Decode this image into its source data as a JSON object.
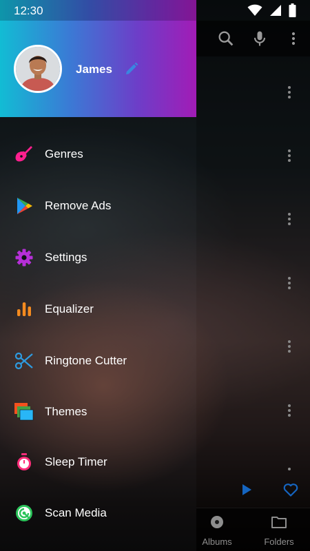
{
  "status_bar": {
    "time": "12:30"
  },
  "drawer": {
    "user": {
      "name": "James"
    },
    "menu": [
      {
        "label": "Genres",
        "icon": "guitar-icon",
        "color": "#ff1f8e"
      },
      {
        "label": "Remove Ads",
        "icon": "play-store-icon",
        "color": "#34a853"
      },
      {
        "label": "Settings",
        "icon": "gear-icon",
        "color": "#b62fd8"
      },
      {
        "label": "Equalizer",
        "icon": "equalizer-icon",
        "color": "#f58b1f"
      },
      {
        "label": "Ringtone Cutter",
        "icon": "scissors-icon",
        "color": "#2e9be0"
      },
      {
        "label": "Themes",
        "icon": "themes-icon",
        "color": "#4caf50"
      },
      {
        "label": "Sleep Timer",
        "icon": "stopwatch-icon",
        "color": "#ff2d7a"
      },
      {
        "label": "Scan Media",
        "icon": "scan-icon",
        "color": "#2bc45a"
      }
    ]
  },
  "bottom_nav": {
    "albums": "Albums",
    "folders": "Folders"
  },
  "colors": {
    "accent_blue": "#1565c0"
  }
}
